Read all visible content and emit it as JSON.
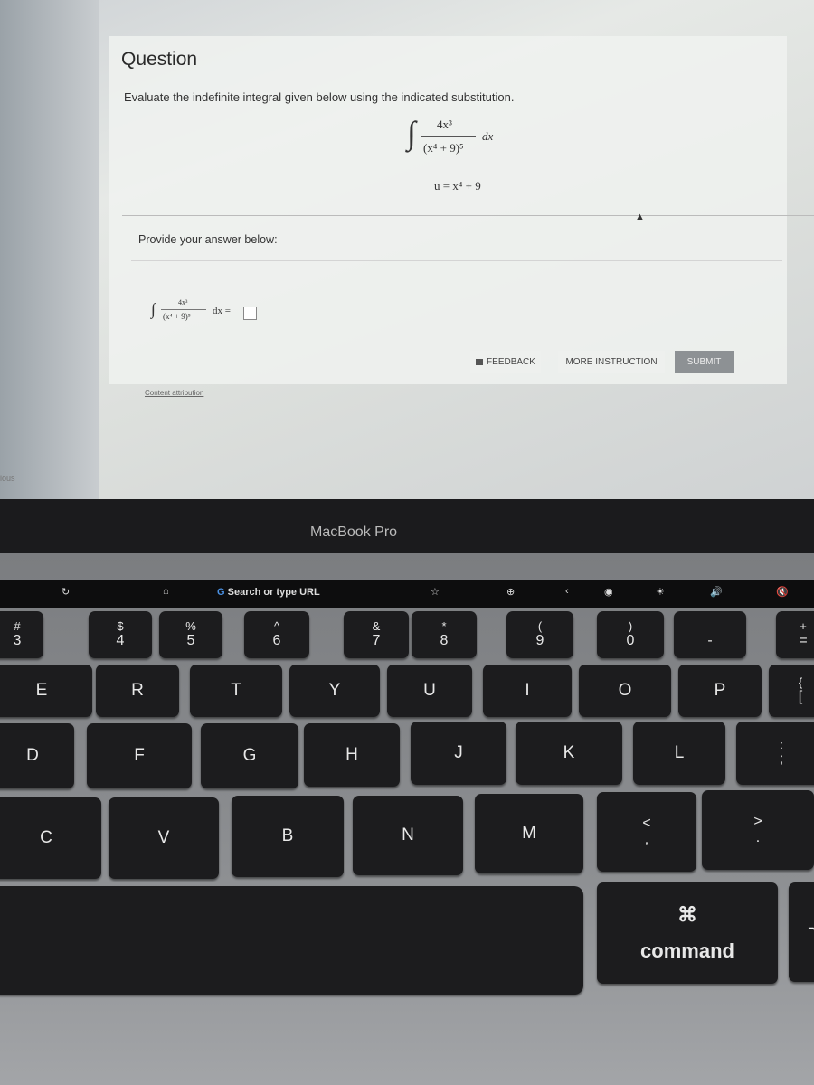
{
  "screen": {
    "sidebar_prev": "ious",
    "question_title": "Question",
    "question_text": "Evaluate the indefinite integral given below using the indicated substitution.",
    "integral": {
      "numerator": "4x³",
      "denominator": "(x⁴ + 9)⁵",
      "dx": "dx"
    },
    "substitution": "u = x⁴ + 9",
    "provide_label": "Provide your answer below:",
    "answer_expr": {
      "numerator": "4x³",
      "denominator": "(x⁴ + 9)⁵",
      "suffix": "dx ="
    },
    "answer_value": "",
    "buttons": {
      "feedback": "FEEDBACK",
      "more_instruction": "MORE INSTRUCTION",
      "submit": "SUBMIT"
    },
    "content_attribution": "Content attribution"
  },
  "laptop": {
    "brand": "MacBook Pro",
    "touchbar": {
      "url_placeholder": "Search or type URL"
    },
    "keys": {
      "k3": [
        "#",
        "3"
      ],
      "k4": [
        "$",
        "4"
      ],
      "k5": [
        "%",
        "5"
      ],
      "k6": [
        "^",
        "6"
      ],
      "k7": [
        "&",
        "7"
      ],
      "k8": [
        "*",
        "8"
      ],
      "k9": [
        "(",
        "9"
      ],
      "k0": [
        ")",
        "0"
      ],
      "kminus": [
        "—",
        "-"
      ],
      "kplus": [
        "+",
        "="
      ],
      "E": "E",
      "R": "R",
      "T": "T",
      "Y": "Y",
      "U": "U",
      "I": "I",
      "O": "O",
      "P": "P",
      "brace": [
        "{",
        "["
      ],
      "D": "D",
      "F": "F",
      "G": "G",
      "H": "H",
      "J": "J",
      "K": "K",
      "L": "L",
      "semi": [
        ":",
        ";"
      ],
      "C": "C",
      "V": "V",
      "B": "B",
      "N": "N",
      "M": "M",
      "lt": [
        "<",
        ","
      ],
      "gt": [
        ">",
        "."
      ],
      "command_symbol": "⌘",
      "command": "command"
    }
  }
}
